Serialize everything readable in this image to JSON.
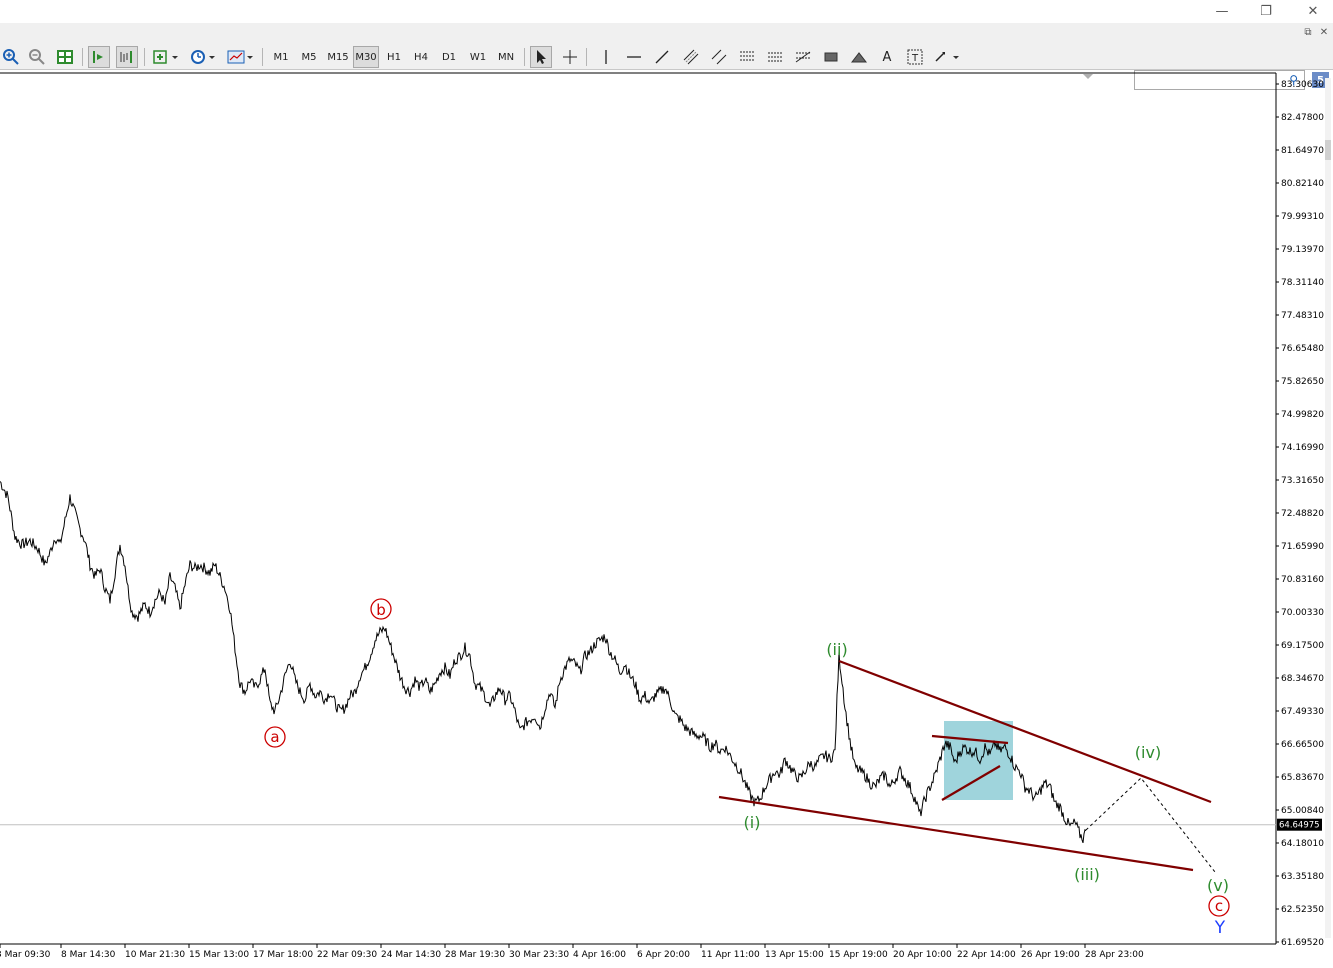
{
  "window": {
    "minimize_glyph": "—",
    "restore_glyph": "❐",
    "close_glyph": "✕",
    "inner_restore_glyph": "⧉",
    "inner_close_glyph": "✕"
  },
  "toolbar": {
    "timeframes": [
      "M1",
      "M5",
      "M15",
      "M30",
      "H1",
      "H4",
      "D1",
      "W1",
      "MN"
    ],
    "active_timeframe": "M30",
    "text_tool": "A",
    "label_tool": "T"
  },
  "badge": "5",
  "chart_data": {
    "type": "line",
    "price_labels": [
      "83.30630",
      "82.47800",
      "81.64970",
      "80.82140",
      "79.99310",
      "79.13970",
      "78.31140",
      "77.48310",
      "76.65480",
      "75.82650",
      "74.99820",
      "74.16990",
      "73.31650",
      "72.48820",
      "71.65990",
      "70.83160",
      "70.00330",
      "69.17500",
      "68.34670",
      "67.49330",
      "66.66500",
      "65.83670",
      "65.00840",
      "64.18010",
      "63.35180",
      "62.52350",
      "61.69520"
    ],
    "current_price": "64.64975",
    "x_labels": [
      "3 Mar 09:30",
      "8 Mar 14:30",
      "10 Mar 21:30",
      "15 Mar 13:00",
      "17 Mar 18:00",
      "22 Mar 09:30",
      "24 Mar 14:30",
      "28 Mar 19:30",
      "30 Mar 23:30",
      "4 Apr 16:00",
      "6 Apr 20:00",
      "11 Apr 11:00",
      "13 Apr 15:00",
      "15 Apr 19:00",
      "20 Apr 10:00",
      "22 Apr 14:00",
      "26 Apr 19:00",
      "28 Apr 23:00"
    ],
    "price_path": [
      [
        0,
        73.3
      ],
      [
        8,
        72.9
      ],
      [
        15,
        71.9
      ],
      [
        22,
        71.7
      ],
      [
        30,
        71.8
      ],
      [
        38,
        71.6
      ],
      [
        45,
        71.2
      ],
      [
        50,
        71.5
      ],
      [
        55,
        71.9
      ],
      [
        60,
        71.7
      ],
      [
        65,
        72.3
      ],
      [
        70,
        72.9
      ],
      [
        75,
        72.5
      ],
      [
        80,
        72.1
      ],
      [
        85,
        71.8
      ],
      [
        90,
        71.2
      ],
      [
        95,
        70.9
      ],
      [
        100,
        71.1
      ],
      [
        105,
        70.6
      ],
      [
        110,
        70.3
      ],
      [
        115,
        71.0
      ],
      [
        120,
        71.7
      ],
      [
        125,
        71.2
      ],
      [
        128,
        70.6
      ],
      [
        132,
        70.0
      ],
      [
        138,
        69.9
      ],
      [
        145,
        70.2
      ],
      [
        150,
        70.0
      ],
      [
        155,
        70.3
      ],
      [
        160,
        70.5
      ],
      [
        165,
        70.2
      ],
      [
        170,
        70.9
      ],
      [
        175,
        70.6
      ],
      [
        180,
        70.1
      ],
      [
        185,
        70.7
      ],
      [
        190,
        71.2
      ],
      [
        195,
        71.1
      ],
      [
        200,
        71.2
      ],
      [
        205,
        71.1
      ],
      [
        210,
        71.0
      ],
      [
        215,
        71.2
      ],
      [
        220,
        70.9
      ],
      [
        225,
        70.6
      ],
      [
        230,
        70.1
      ],
      [
        233,
        69.5
      ],
      [
        236,
        68.9
      ],
      [
        240,
        68.2
      ],
      [
        245,
        68.0
      ],
      [
        250,
        68.3
      ],
      [
        255,
        68.1
      ],
      [
        260,
        68.3
      ],
      [
        265,
        68.6
      ],
      [
        270,
        67.7
      ],
      [
        275,
        67.5
      ],
      [
        280,
        67.9
      ],
      [
        285,
        68.4
      ],
      [
        290,
        68.8
      ],
      [
        295,
        68.3
      ],
      [
        300,
        68.0
      ],
      [
        305,
        67.8
      ],
      [
        310,
        68.2
      ],
      [
        315,
        67.9
      ],
      [
        320,
        68.0
      ],
      [
        325,
        67.8
      ],
      [
        330,
        68.0
      ],
      [
        335,
        67.7
      ],
      [
        340,
        67.5
      ],
      [
        345,
        67.6
      ],
      [
        350,
        67.9
      ],
      [
        355,
        68.0
      ],
      [
        360,
        68.4
      ],
      [
        365,
        68.6
      ],
      [
        370,
        68.9
      ],
      [
        375,
        69.3
      ],
      [
        380,
        69.5
      ],
      [
        385,
        69.6
      ],
      [
        390,
        69.2
      ],
      [
        395,
        68.8
      ],
      [
        400,
        68.4
      ],
      [
        405,
        68.1
      ],
      [
        410,
        68.0
      ],
      [
        415,
        68.3
      ],
      [
        420,
        68.1
      ],
      [
        425,
        68.3
      ],
      [
        430,
        68.0
      ],
      [
        435,
        68.2
      ],
      [
        440,
        68.5
      ],
      [
        445,
        68.6
      ],
      [
        450,
        68.4
      ],
      [
        455,
        68.8
      ],
      [
        460,
        68.9
      ],
      [
        465,
        69.1
      ],
      [
        470,
        68.9
      ],
      [
        475,
        68.2
      ],
      [
        480,
        68.1
      ],
      [
        485,
        67.9
      ],
      [
        490,
        67.6
      ],
      [
        495,
        67.9
      ],
      [
        500,
        68.1
      ],
      [
        505,
        67.8
      ],
      [
        510,
        67.9
      ],
      [
        515,
        67.5
      ],
      [
        520,
        67.0
      ],
      [
        525,
        67.2
      ],
      [
        530,
        67.3
      ],
      [
        535,
        67.4
      ],
      [
        540,
        67.1
      ],
      [
        545,
        67.6
      ],
      [
        550,
        68.0
      ],
      [
        555,
        67.6
      ],
      [
        560,
        68.3
      ],
      [
        565,
        68.6
      ],
      [
        570,
        68.8
      ],
      [
        575,
        68.7
      ],
      [
        580,
        68.5
      ],
      [
        585,
        68.9
      ],
      [
        590,
        69.0
      ],
      [
        595,
        69.2
      ],
      [
        600,
        69.3
      ],
      [
        605,
        69.4
      ],
      [
        610,
        69.0
      ],
      [
        615,
        68.8
      ],
      [
        620,
        68.5
      ],
      [
        625,
        68.7
      ],
      [
        630,
        68.4
      ],
      [
        635,
        68.2
      ],
      [
        640,
        67.8
      ],
      [
        645,
        67.9
      ],
      [
        650,
        67.7
      ],
      [
        655,
        67.9
      ],
      [
        660,
        68.0
      ],
      [
        665,
        68.1
      ],
      [
        670,
        67.8
      ],
      [
        675,
        67.4
      ],
      [
        680,
        67.3
      ],
      [
        685,
        67.1
      ],
      [
        690,
        67.0
      ],
      [
        695,
        66.9
      ],
      [
        700,
        66.9
      ],
      [
        705,
        66.8
      ],
      [
        710,
        66.6
      ],
      [
        715,
        66.7
      ],
      [
        720,
        66.5
      ],
      [
        725,
        66.6
      ],
      [
        730,
        66.4
      ],
      [
        735,
        66.2
      ],
      [
        740,
        66.0
      ],
      [
        745,
        65.7
      ],
      [
        750,
        65.4
      ],
      [
        755,
        65.2
      ],
      [
        760,
        65.3
      ],
      [
        765,
        65.6
      ],
      [
        770,
        65.8
      ],
      [
        775,
        66.0
      ],
      [
        780,
        65.9
      ],
      [
        785,
        66.3
      ],
      [
        790,
        66.1
      ],
      [
        795,
        65.9
      ],
      [
        800,
        65.8
      ],
      [
        805,
        66.0
      ],
      [
        810,
        66.2
      ],
      [
        815,
        66.1
      ],
      [
        820,
        66.3
      ],
      [
        825,
        66.4
      ],
      [
        830,
        66.3
      ],
      [
        835,
        66.5
      ],
      [
        837,
        67.8
      ],
      [
        839,
        68.9
      ],
      [
        841,
        68.5
      ],
      [
        843,
        68.1
      ],
      [
        845,
        67.6
      ],
      [
        848,
        67.1
      ],
      [
        851,
        66.6
      ],
      [
        855,
        66.1
      ],
      [
        860,
        66.0
      ],
      [
        865,
        65.9
      ],
      [
        870,
        65.7
      ],
      [
        875,
        65.6
      ],
      [
        880,
        65.8
      ],
      [
        885,
        65.9
      ],
      [
        890,
        65.6
      ],
      [
        895,
        65.8
      ],
      [
        900,
        66.0
      ],
      [
        905,
        65.8
      ],
      [
        910,
        65.6
      ],
      [
        915,
        65.3
      ],
      [
        920,
        64.9
      ],
      [
        925,
        65.3
      ],
      [
        930,
        65.6
      ],
      [
        935,
        65.9
      ],
      [
        940,
        66.3
      ],
      [
        945,
        66.7
      ],
      [
        950,
        66.6
      ],
      [
        955,
        66.2
      ],
      [
        960,
        66.5
      ],
      [
        965,
        66.6
      ],
      [
        970,
        66.5
      ],
      [
        975,
        66.5
      ],
      [
        980,
        66.3
      ],
      [
        985,
        66.6
      ],
      [
        990,
        66.4
      ],
      [
        995,
        66.7
      ],
      [
        1000,
        66.5
      ],
      [
        1005,
        66.6
      ],
      [
        1010,
        66.4
      ],
      [
        1015,
        66.1
      ],
      [
        1020,
        66.0
      ],
      [
        1025,
        65.6
      ],
      [
        1030,
        65.5
      ],
      [
        1035,
        65.3
      ],
      [
        1040,
        65.5
      ],
      [
        1045,
        65.7
      ],
      [
        1050,
        65.6
      ],
      [
        1055,
        65.2
      ],
      [
        1060,
        65.1
      ],
      [
        1065,
        64.8
      ],
      [
        1070,
        64.6
      ],
      [
        1075,
        64.7
      ],
      [
        1080,
        64.4
      ],
      [
        1083,
        64.3
      ],
      [
        1086,
        64.5
      ]
    ]
  },
  "labels": {
    "wave_a": "a",
    "wave_b": "b",
    "wave_i": "(i)",
    "wave_ii": "(ii)",
    "wave_iii": "(iii)",
    "wave_iv": "(iv)",
    "wave_v": "(v)",
    "wave_c": "c",
    "wave_y": "Y"
  },
  "colors": {
    "price_line": "#000000",
    "trendline": "#800000",
    "label_red": "#cc0000",
    "label_green": "#2e8b2e",
    "label_blue": "#1f3fff",
    "highlight": "#8ecdd6",
    "grid_line": "#c0c0c0"
  }
}
